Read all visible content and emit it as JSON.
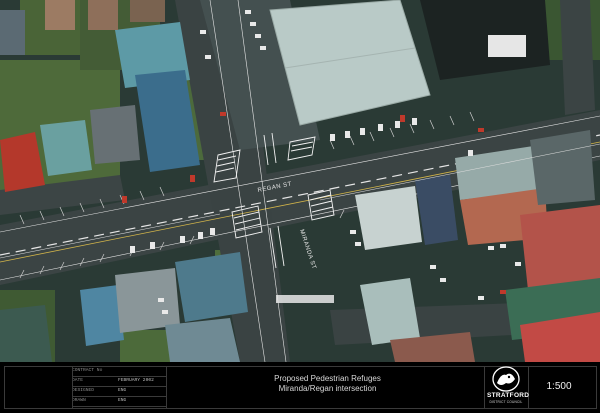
{
  "map": {
    "street_labels": {
      "regan": "REGAN ST",
      "miranda": "MIRANDA ST"
    }
  },
  "title_block": {
    "rows": [
      {
        "label": "CONTRACT No",
        "value": ""
      },
      {
        "label": "DATE",
        "value": "FEBRUARY 2002"
      },
      {
        "label": "DESIGNED",
        "value": "ENG"
      },
      {
        "label": "DRAWN",
        "value": "ENG"
      }
    ],
    "title_line1": "Proposed Pedestrian Refuges",
    "title_line2": "Miranda/Regan intersection",
    "scale": "1:500",
    "logo_name": "STRATFORD",
    "logo_sub": "DISTRICT COUNCIL"
  }
}
